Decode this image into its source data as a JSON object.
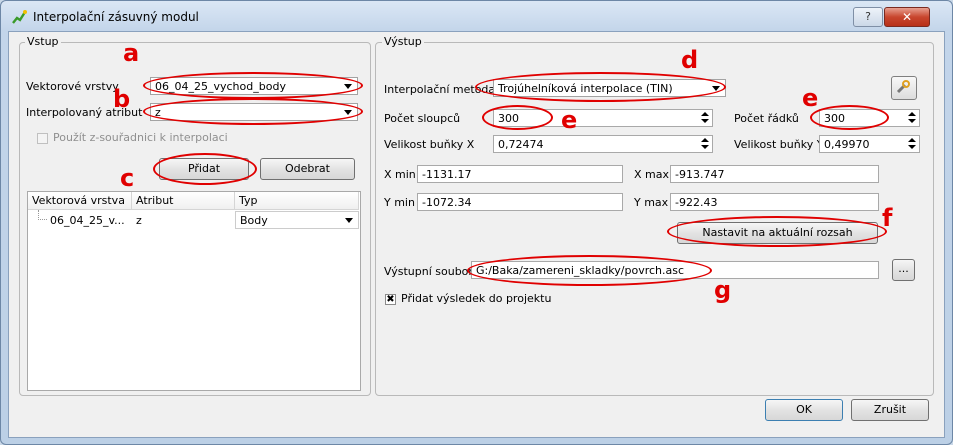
{
  "window": {
    "title": "Interpolační zásuvný modul"
  },
  "input": {
    "group_label": "Vstup",
    "vector_layers_label": "Vektorové vrstvy",
    "vector_layers_value": "06_04_25_vychod_body",
    "attribute_label": "Interpolovaný atribut",
    "attribute_value": "z",
    "use_z_label": "Použít z-souřadnici k interpolaci",
    "add_label": "Přidat",
    "remove_label": "Odebrat",
    "table": {
      "headers": [
        "Vektorová vrstva",
        "Atribut",
        "Typ"
      ],
      "rows": [
        {
          "layer": "06_04_25_v...",
          "attribute": "z",
          "type": "Body"
        }
      ]
    }
  },
  "output": {
    "group_label": "Výstup",
    "method_label": "Interpolační metoda",
    "method_value": "Trojúhelníková interpolace (TIN)",
    "cols_label": "Počet sloupců",
    "cols_value": "300",
    "rows_label": "Počet řádků",
    "rows_value": "300",
    "cell_x_label": "Velikost buňky X",
    "cell_x_value": "0,72474",
    "cell_y_label": "Velikost buňky Y",
    "cell_y_value": "0,49970",
    "xmin_label": "X min",
    "xmin_value": "-1131.17",
    "xmax_label": "X max",
    "xmax_value": "-913.747",
    "ymin_label": "Y min",
    "ymin_value": "-1072.34",
    "ymax_label": "Y max",
    "ymax_value": "-922.43",
    "set_extent_label": "Nastavit na aktuální rozsah",
    "output_file_label": "Výstupní soubor",
    "output_file_value": "G:/Baka/zamereni_skladky/povrch.asc",
    "browse_label": "...",
    "add_to_project_label": "Přidat výsledek do projektu"
  },
  "buttons": {
    "ok": "OK",
    "cancel": "Zrušit"
  },
  "annotations": {
    "a": "a",
    "b": "b",
    "c": "c",
    "d": "d",
    "e1": "e",
    "e2": "e",
    "f": "f",
    "g": "g"
  },
  "colors": {
    "annotation": "#e00000",
    "titlebar": "#c3d5ea"
  }
}
